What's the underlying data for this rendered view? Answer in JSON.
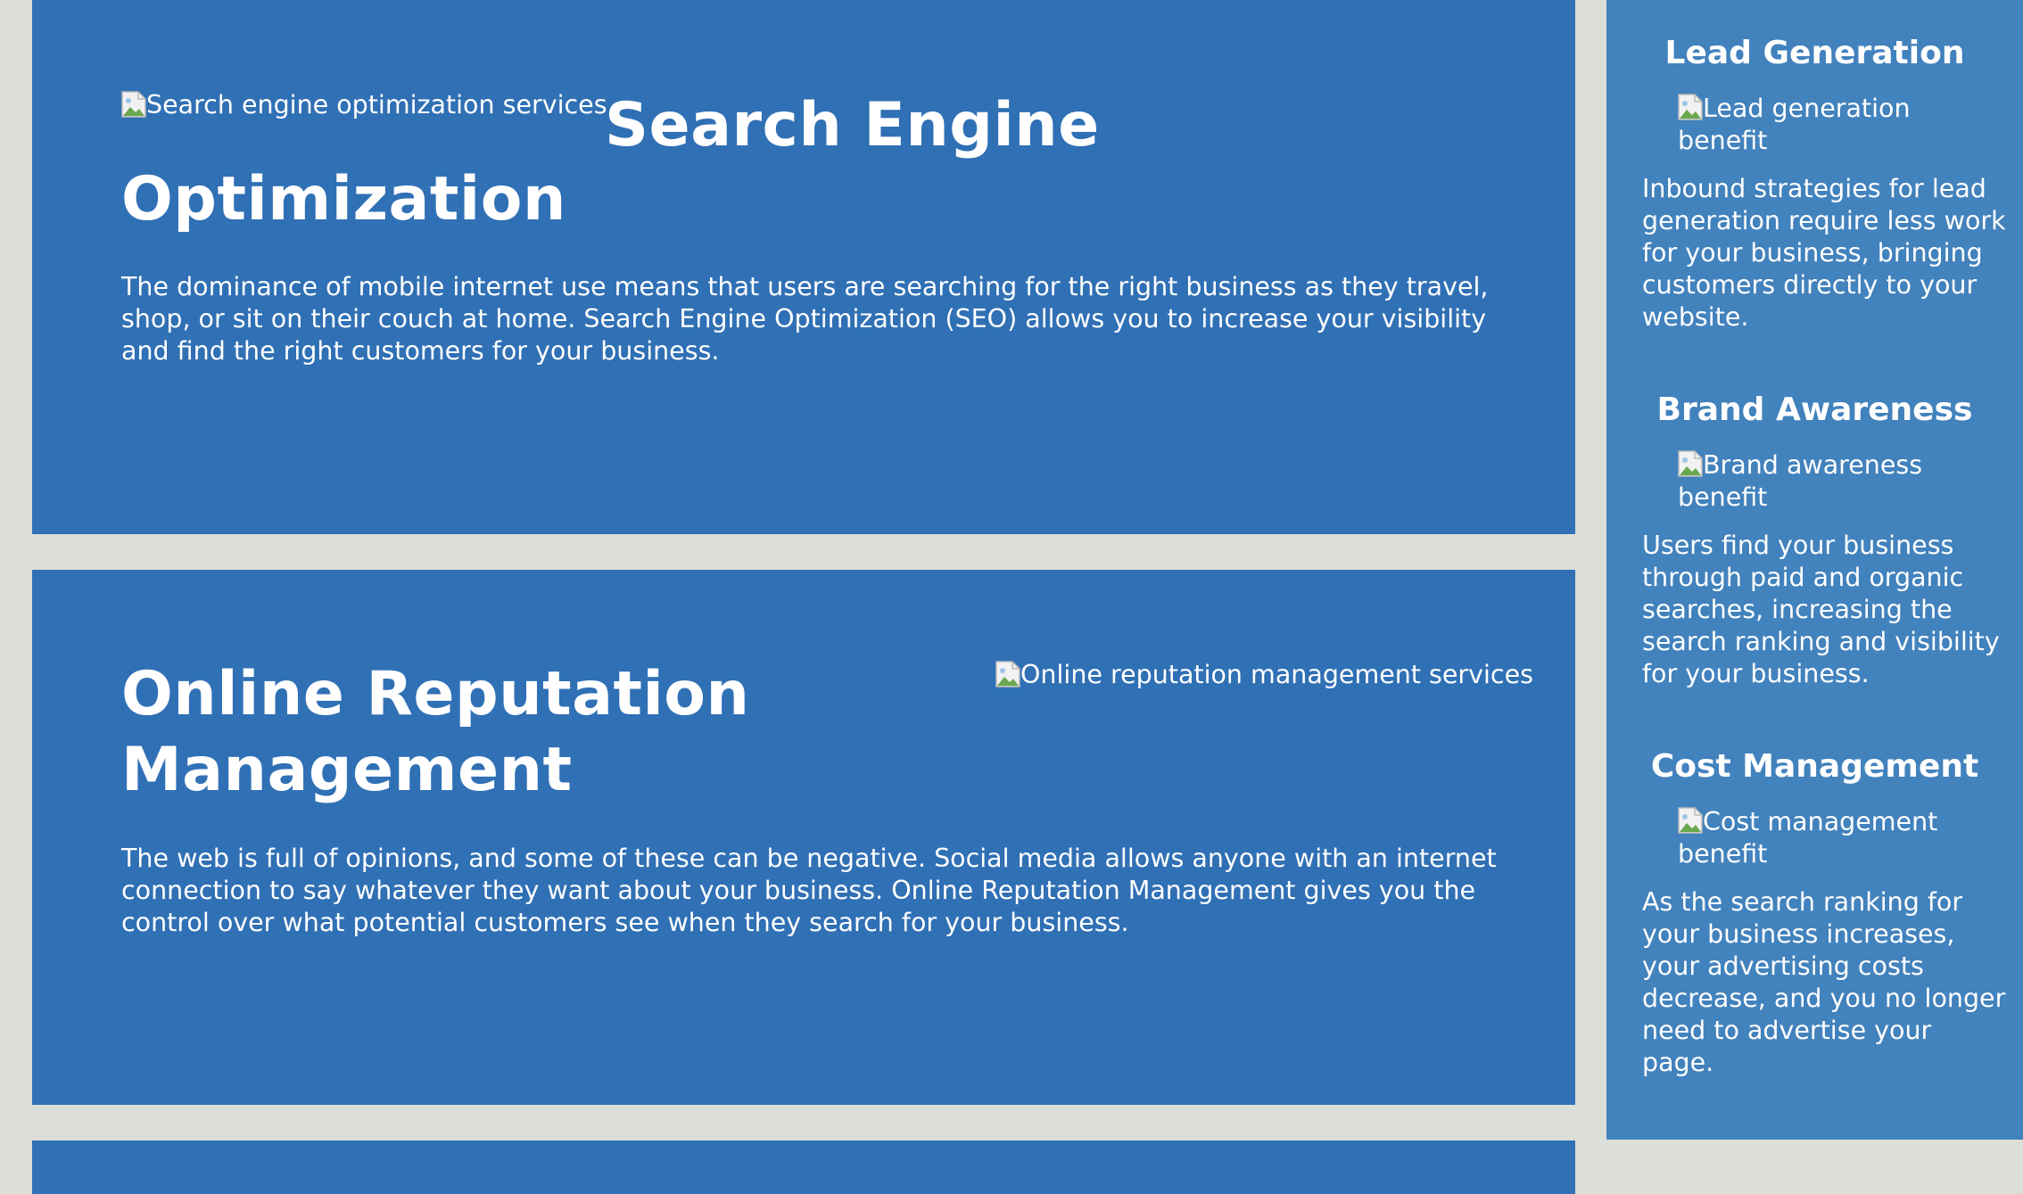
{
  "colors": {
    "page_background": "#dcded9",
    "card_background": "#3070b5",
    "sidebar_background": "#4282bd",
    "text": "#ffffff"
  },
  "sections": [
    {
      "image_alt": "Search engine optimization services",
      "heading": "Search Engine Optimization",
      "body": "The dominance of mobile internet use means that users are searching for the right business as they travel, shop, or sit on their couch at home. Search Engine Optimization (SEO) allows you to increase your visibility and find the right customers for your business."
    },
    {
      "image_alt": "Online reputation management services",
      "heading": "Online Reputation Management",
      "body": "The web is full of opinions, and some of these can be negative. Social media allows anyone with an internet connection to say whatever they want about your business. Online Reputation Management gives you the control over what potential customers see when they search for your business."
    }
  ],
  "benefits": [
    {
      "title": "Lead Generation",
      "image_alt": "Lead generation benefit",
      "text": "Inbound strategies for lead generation require less work for your business, bringing customers directly to your website."
    },
    {
      "title": "Brand Awareness",
      "image_alt": "Brand awareness benefit",
      "text": "Users find your business through paid and organic searches, increasing the search ranking and visibility for your business."
    },
    {
      "title": "Cost Management",
      "image_alt": "Cost management benefit",
      "text": "As the search ranking for your business increases, your advertising costs decrease, and you no longer need to advertise your page."
    }
  ]
}
